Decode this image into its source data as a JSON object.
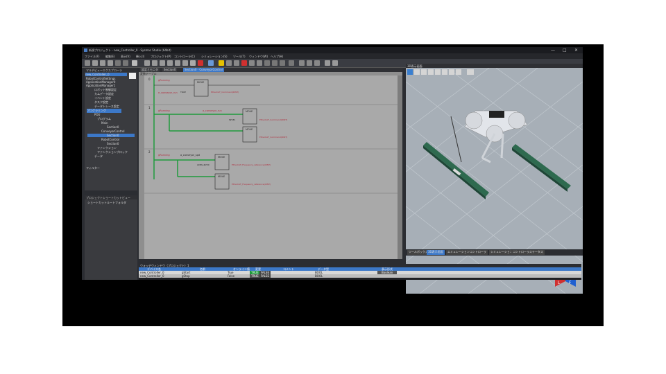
{
  "window": {
    "title": "新規プロジェクト - new_Controller_0 - Sysmac Studio (64bit)",
    "controls": [
      "—",
      "□",
      "✕"
    ]
  },
  "menu": [
    "ファイル(F)",
    "編集(E)",
    "表示(V)",
    "挿入(I)",
    "プロジェクト(P)",
    "コントローラ(C)",
    "シミュレーション(S)",
    "ツール(T)",
    "ウィンドウ(W)",
    "ヘルプ(H)"
  ],
  "multiview": {
    "title": "マルチビューエクスプローラ",
    "controller": "new_Controller_0",
    "items": [
      "RobotControlSettings",
      "ApplicationManager0",
      "ApplicationManager1",
      "ロボット制御設定",
      "カムデータ設定",
      "イベント設定",
      "タスク設定",
      "データトレース設定",
      "プログラミング",
      "POU",
      "プログラム",
      "Main",
      "Section0",
      "ConveyorControl",
      "Section0",
      "RobotControl",
      "Section0",
      "ファンクション",
      "ファンクションブロック",
      "データ"
    ],
    "filter": "フィルター"
  },
  "shortcut": {
    "title": "プロジェクトショートカットビュー",
    "folder": "ショートカットルートフォルダ"
  },
  "editor": {
    "tabs": [
      "設定とモニタ",
      "Section0",
      "Section0 - ConveyorControl"
    ],
    "var_table": "変数テーブル",
    "rungs": [
      {
        "no": "0",
        "contact": "gRunning",
        "contact2": "e_conveyor_run",
        "block": "MOVE",
        "in_var": "TRUE",
        "out_var": "EtherCAT_Command(DINT)"
      },
      {
        "no": "1",
        "contact": "gRunning",
        "contact2": "a_conveyor_run",
        "block": "MOVE",
        "in_var": "INT#1",
        "out_var": "EtherCAT_Command(DINT)"
      },
      {
        "no": "2",
        "contact": "gRunning",
        "contact2": "a_conveyor_spd",
        "block": "MOVE",
        "in_var": "LREAL#250",
        "out_var": "EtherCAT_Frequency_reference(UINT)"
      }
    ],
    "side_label": "変数テーブル"
  },
  "view3d": {
    "title": "3D表示画面",
    "cube_labels": [
      "U",
      "L",
      "F"
    ],
    "bottom_tabs": [
      "ツールボックス",
      "3D表示画面",
      "エミュレーションコントローラ",
      "シミュレーション",
      "コントローラステータス"
    ]
  },
  "watch": {
    "title": "ウォッチウィンドウ（プロジェクト）1",
    "columns": [
      "デバイス名",
      "名前",
      "オンライン値",
      "変更",
      "コメント",
      "データ型",
      "表示形式"
    ],
    "rows": [
      {
        "device": "new_Controller_0",
        "name": "gStart",
        "value": "True",
        "change_on": "TRUE",
        "change_off": "FALSE",
        "comment": "",
        "type": "BOOL",
        "format": "Boolean"
      },
      {
        "device": "new_Controller_0",
        "name": "gStop",
        "value": "False",
        "change_on": "TRUE",
        "change_off": "FALSE",
        "comment": "",
        "type": "BOOL",
        "format": ""
      }
    ]
  },
  "colors": {
    "accent": "#3c78c8",
    "rung_active": "#1f9a3c",
    "warning": "#e6c200",
    "danger": "#d03030"
  }
}
